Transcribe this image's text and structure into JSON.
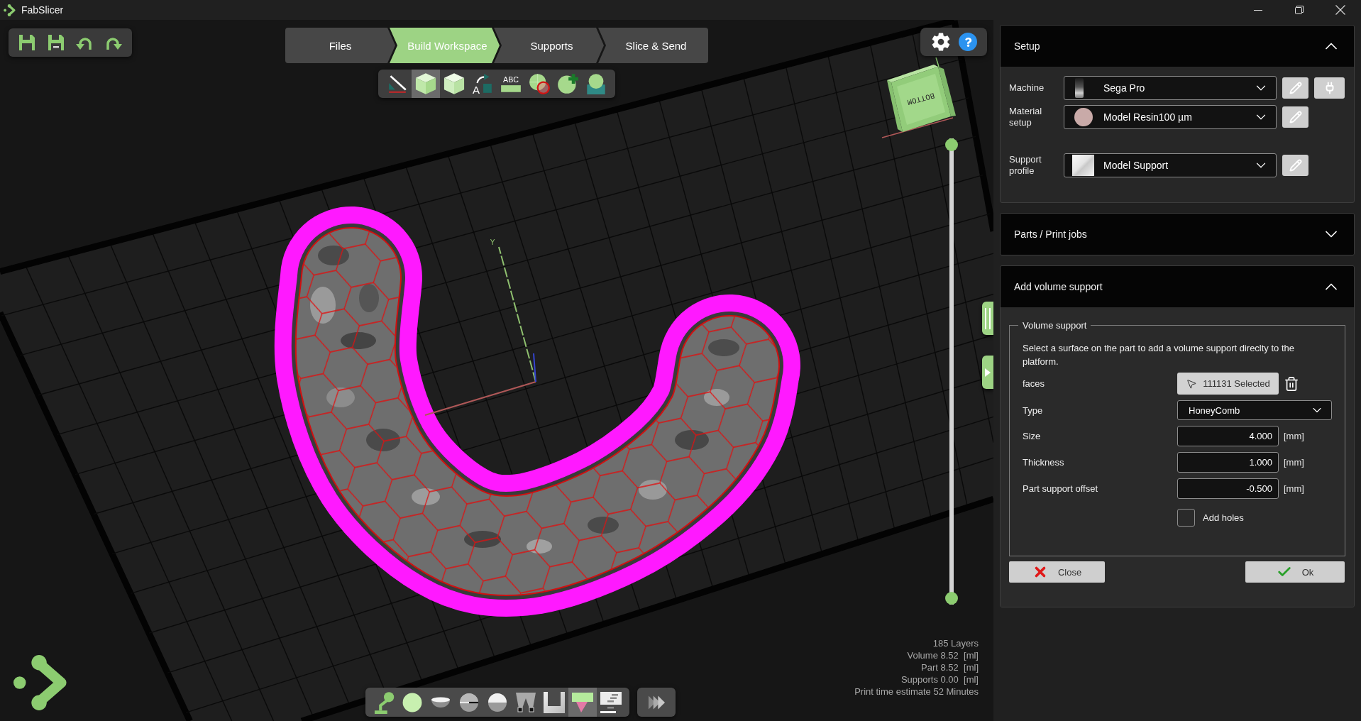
{
  "window": {
    "title": "FabSlicer"
  },
  "workflow_tabs": [
    {
      "label": "Files",
      "selected": false
    },
    {
      "label": "Build Workspace",
      "selected": true
    },
    {
      "label": "Supports",
      "selected": false
    },
    {
      "label": "Slice & Send",
      "selected": false
    }
  ],
  "build_tools": [
    {
      "kind": "measure",
      "selected": false
    },
    {
      "kind": "cube_solid",
      "selected": true
    },
    {
      "kind": "cube",
      "selected": false
    },
    {
      "kind": "emboss",
      "glyph": "A",
      "selected": false
    },
    {
      "kind": "label",
      "glyph": "ABC",
      "selected": false
    },
    {
      "kind": "cut",
      "selected": false
    },
    {
      "kind": "add",
      "selected": false
    },
    {
      "kind": "base",
      "selected": false
    }
  ],
  "view_cube": {
    "face": "BOTTOM"
  },
  "axes": {
    "y_label": "Y"
  },
  "layer_slider": {
    "upper": {
      "level": 1
    },
    "lower": {
      "level": 0
    }
  },
  "stats": [
    "185 Layers",
    "Volume 8.52  [ml]",
    "Part 8.52  [ml]",
    "Supports 0.00  [ml]",
    "Print time estimate 52 Minutes"
  ],
  "support_tools": [
    {
      "kind": "pin",
      "selected": false
    },
    {
      "kind": "sphere",
      "selected": false
    },
    {
      "kind": "disc",
      "selected": false
    },
    {
      "kind": "split",
      "selected": false
    },
    {
      "kind": "half",
      "selected": false
    },
    {
      "kind": "feet",
      "selected": false
    },
    {
      "kind": "tray",
      "selected": false
    },
    {
      "kind": "overhang",
      "selected": true
    },
    {
      "kind": "layers",
      "selected": false
    }
  ],
  "setup": {
    "title": "Setup",
    "expanded": true,
    "rows": [
      {
        "kind": "machine",
        "label": "Machine",
        "value": "Sega Pro",
        "actions": [
          {
            "kind": "edit"
          },
          {
            "kind": "connect"
          }
        ]
      },
      {
        "kind": "material",
        "label": "Material setup",
        "value": "Model Resin100 µm",
        "color": "#c9aaa8",
        "actions": [
          {
            "kind": "edit"
          }
        ]
      },
      {
        "kind": "support",
        "label": "Support profile",
        "value": "Model Support",
        "actions": [
          {
            "kind": "edit"
          }
        ]
      }
    ]
  },
  "parts": {
    "title": "Parts / Print jobs",
    "expanded": false
  },
  "volume_support": {
    "title": "Add volume support",
    "expanded": true,
    "legend": "Volume support",
    "description": "Select a surface on the part to add a volume support direclty to the platform.",
    "faces": {
      "label": "faces",
      "button": "111131 Selected"
    },
    "type": {
      "label": "Type",
      "value": "HoneyComb"
    },
    "fields": [
      {
        "label": "Size",
        "value": "4.000",
        "unit": "[mm]"
      },
      {
        "label": "Thickness",
        "value": "1.000",
        "unit": "[mm]"
      },
      {
        "label": "Part support offset",
        "value": "-0.500",
        "unit": "[mm]"
      }
    ],
    "add_holes": {
      "label": "Add holes",
      "checked": false
    },
    "buttons": [
      {
        "kind": "close",
        "label": "Close"
      },
      {
        "kind": "ok",
        "label": "Ok"
      }
    ]
  }
}
